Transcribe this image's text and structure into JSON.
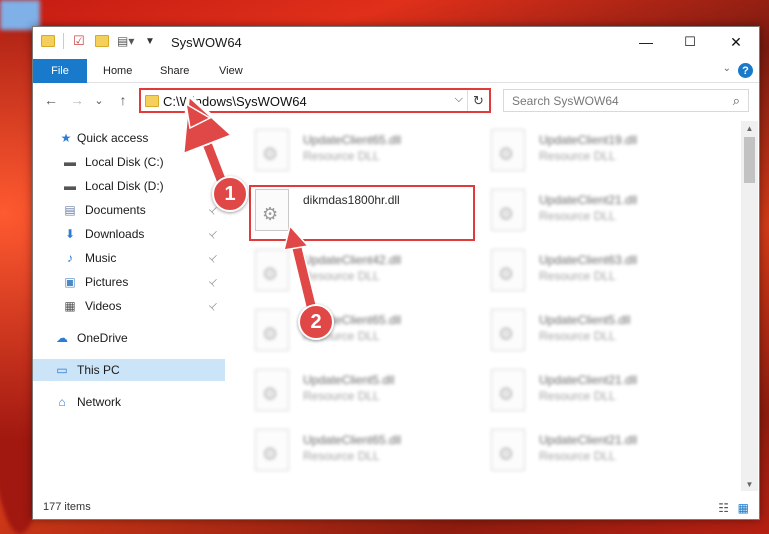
{
  "window": {
    "title": "SysWOW64",
    "controls": {
      "minimize": "—",
      "maximize": "☐",
      "close": "✕"
    }
  },
  "ribbon": {
    "tabs": [
      {
        "label": "File"
      },
      {
        "label": "Home"
      },
      {
        "label": "Share"
      },
      {
        "label": "View"
      }
    ],
    "collapse_icon": "chevron-down-icon",
    "help_label": "?"
  },
  "address_bar": {
    "path": "C:\\Windows\\SysWOW64",
    "dropdown_glyph": "⌵",
    "refresh_glyph": "↻"
  },
  "search": {
    "placeholder": "Search SysWOW64",
    "icon_glyph": "⌕"
  },
  "nav_buttons": {
    "back": "←",
    "forward": "→",
    "recent": "⌄",
    "up": "↑"
  },
  "sidebar": {
    "items": [
      {
        "label": "Quick access",
        "icon": "star-icon",
        "glyph": "★",
        "color": "#2b7cd3",
        "pinned": false
      },
      {
        "label": "Local Disk (C:)",
        "icon": "drive-icon",
        "glyph": "▬",
        "color": "#555555",
        "pinned": false
      },
      {
        "label": "Local Disk (D:)",
        "icon": "drive-icon",
        "glyph": "▬",
        "color": "#555555",
        "pinned": false
      },
      {
        "label": "Documents",
        "icon": "documents-icon",
        "glyph": "▤",
        "color": "#6a7fa8",
        "pinned": true
      },
      {
        "label": "Downloads",
        "icon": "download-icon",
        "glyph": "⬇",
        "color": "#2b7cd3",
        "pinned": true
      },
      {
        "label": "Music",
        "icon": "music-icon",
        "glyph": "♪",
        "color": "#2b7cd3",
        "pinned": true
      },
      {
        "label": "Pictures",
        "icon": "pictures-icon",
        "glyph": "▣",
        "color": "#4a8ac8",
        "pinned": true
      },
      {
        "label": "Videos",
        "icon": "videos-icon",
        "glyph": "▦",
        "color": "#555555",
        "pinned": true
      },
      {
        "label": "OneDrive",
        "icon": "cloud-icon",
        "glyph": "☁",
        "color": "#2b7cd3",
        "pinned": false
      },
      {
        "label": "This PC",
        "icon": "computer-icon",
        "glyph": "▭",
        "color": "#2b7cd3",
        "pinned": false,
        "selected": true
      },
      {
        "label": "Network",
        "icon": "network-icon",
        "glyph": "⌂",
        "color": "#2b7cd3",
        "pinned": false
      }
    ],
    "pin_glyph": "📌"
  },
  "files": [
    {
      "name": "UpdateClient65.dll",
      "type": "Resource DLL",
      "focus": false
    },
    {
      "name": "UpdateClient19.dll",
      "type": "Resource DLL",
      "focus": false
    },
    {
      "name": "dikmdas1800hr.dll",
      "type": "",
      "focus": true
    },
    {
      "name": "UpdateClient21.dll",
      "type": "Resource DLL",
      "focus": false
    },
    {
      "name": "UpdateClient42.dll",
      "type": "Resource DLL",
      "focus": false
    },
    {
      "name": "UpdateClient63.dll",
      "type": "Resource DLL",
      "focus": false
    },
    {
      "name": "UpdateClient65.dll",
      "type": "Resource DLL",
      "focus": false
    },
    {
      "name": "UpdateClient5.dll",
      "type": "Resource DLL",
      "focus": false
    },
    {
      "name": "UpdateClient5.dll",
      "type": "Resource DLL",
      "focus": false
    },
    {
      "name": "UpdateClient21.dll",
      "type": "Resource DLL",
      "focus": false
    },
    {
      "name": "UpdateClient65.dll",
      "type": "Resource DLL",
      "focus": false
    },
    {
      "name": "UpdateClient21.dll",
      "type": "Resource DLL",
      "focus": false
    }
  ],
  "callouts": [
    {
      "label": "1"
    },
    {
      "label": "2"
    }
  ],
  "status": {
    "item_count": "177 items"
  },
  "colors": {
    "accent": "#1979ca",
    "highlight_red": "#e03a3a",
    "selection": "#cce4f7"
  }
}
